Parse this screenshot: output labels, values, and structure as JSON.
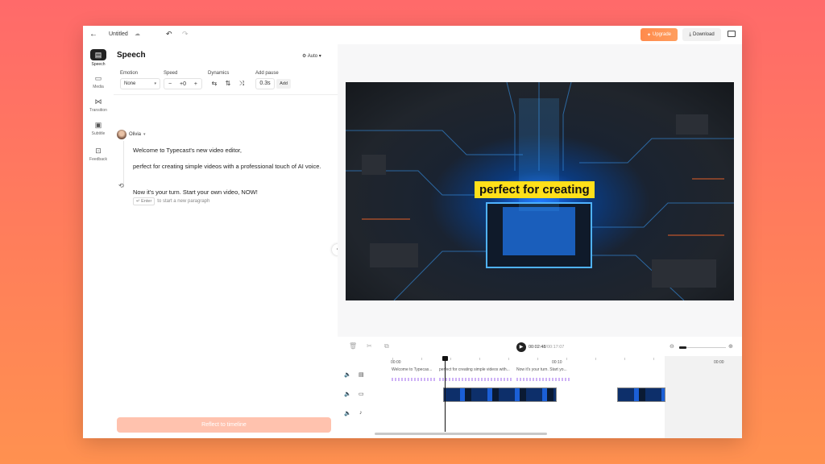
{
  "topbar": {
    "title": "Untitled",
    "upgrade_label": "Upgrade",
    "download_label": "Download"
  },
  "rail": [
    {
      "label": "Speech",
      "icon": "speech-icon"
    },
    {
      "label": "Media",
      "icon": "media-icon"
    },
    {
      "label": "Transition",
      "icon": "transition-icon"
    },
    {
      "label": "Subtitle",
      "icon": "subtitle-icon"
    },
    {
      "label": "Feedback",
      "icon": "feedback-icon"
    }
  ],
  "panel": {
    "title": "Speech",
    "auto_label": "Auto",
    "emotion_label": "Emotion",
    "emotion_value": "None",
    "speed_label": "Speed",
    "speed_value": "+0",
    "dynamics_label": "Dynamics",
    "pause_label": "Add pause",
    "pause_value": "0.3s",
    "pause_add": "Add",
    "voice_name": "Olivia",
    "paragraphs": [
      "Welcome to Typecast's new video editor,",
      "perfect for creating simple videos with a professional touch of AI voice.",
      "Now it's your turn. Start your own video, NOW!"
    ],
    "enter_chip": "↵ Enter",
    "hint_text": "to start a new paragraph",
    "reflect_label": "Reflect to timeline"
  },
  "preview": {
    "subtitle": "perfect for creating"
  },
  "timeline": {
    "current_time": "00:02:48",
    "total_time": "/00:17:07",
    "ruler": [
      "00:00",
      "00:10",
      "00:00"
    ],
    "speech_segments": [
      "Welcome to Typecas...",
      "perfect for creating simple videos with...",
      "Now it's your turn. Start yo..."
    ]
  },
  "colors": {
    "accent": "#ff8a4c",
    "subtitle_bg": "#ffe01a",
    "reflect_button": "#ffc2ae"
  }
}
